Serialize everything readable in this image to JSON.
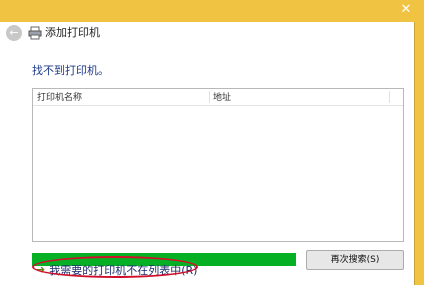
{
  "window": {
    "title": "添加打印机",
    "close_glyph": "✕"
  },
  "icons": {
    "back": "back-arrow-icon",
    "printer": "printer-icon",
    "link_arrow": "arrow-icon"
  },
  "main": {
    "heading": "找不到打印机。",
    "list": {
      "columns": [
        "打印机名称",
        "地址"
      ],
      "rows": []
    },
    "progress": {
      "value": 1.0,
      "color": "#06b025"
    },
    "search_button_label": "再次搜索(S)",
    "not_listed_link": "我需要的打印机不在列表中(R)"
  },
  "colors": {
    "title_bar": "#f0c342",
    "heading_text": "#1e3a8a",
    "annotation": "#d0102a"
  }
}
